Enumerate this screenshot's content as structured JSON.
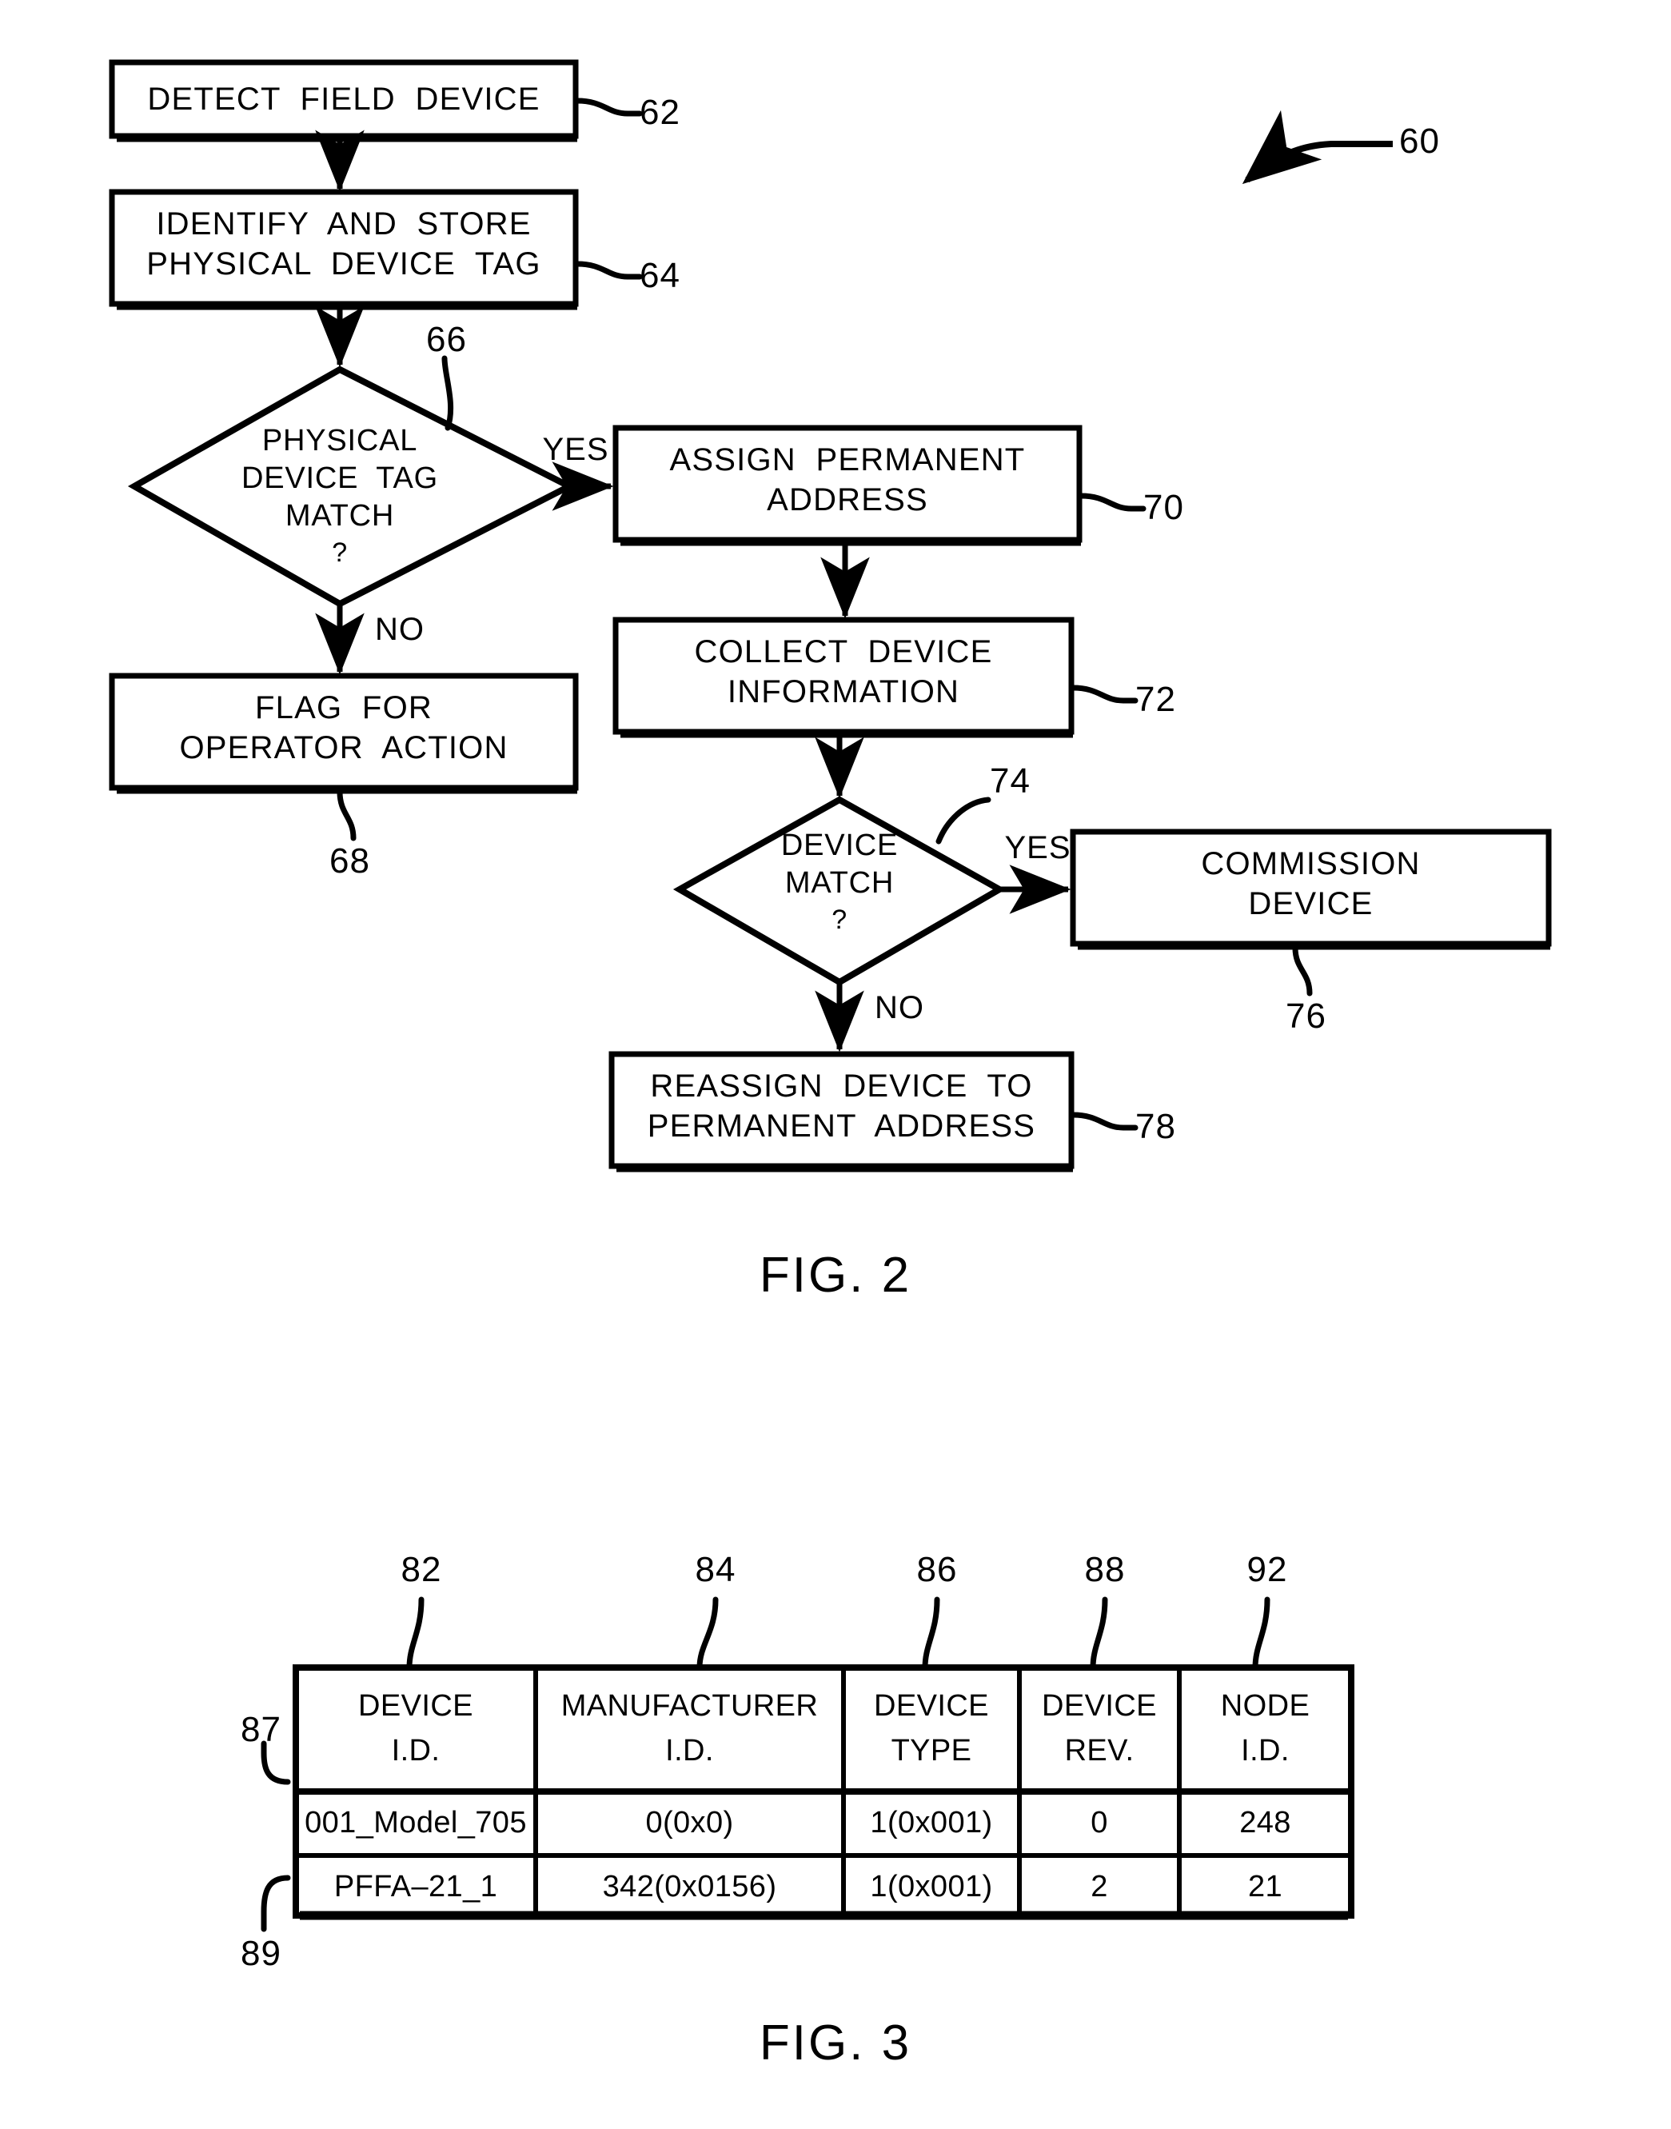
{
  "figure2": {
    "overall_ref": "60",
    "nodes": [
      {
        "id": "n62",
        "ref": "62",
        "type": "process",
        "lines": [
          "DETECT  FIELD  DEVICE"
        ]
      },
      {
        "id": "n64",
        "ref": "64",
        "type": "process",
        "lines": [
          "IDENTIFY  AND  STORE",
          "PHYSICAL  DEVICE  TAG"
        ]
      },
      {
        "id": "n66",
        "ref": "66",
        "type": "decision",
        "lines": [
          "PHYSICAL",
          "DEVICE  TAG",
          "MATCH"
        ],
        "question_mark": "?"
      },
      {
        "id": "n68",
        "ref": "68",
        "type": "process",
        "lines": [
          "FLAG  FOR",
          "OPERATOR  ACTION"
        ]
      },
      {
        "id": "n70",
        "ref": "70",
        "type": "process",
        "lines": [
          "ASSIGN  PERMANENT",
          "ADDRESS"
        ]
      },
      {
        "id": "n72",
        "ref": "72",
        "type": "process",
        "lines": [
          "COLLECT  DEVICE",
          "INFORMATION"
        ]
      },
      {
        "id": "n74",
        "ref": "74",
        "type": "decision",
        "lines": [
          "DEVICE",
          "MATCH"
        ],
        "question_mark": "?"
      },
      {
        "id": "n76",
        "ref": "76",
        "type": "process",
        "lines": [
          "COMMISSION",
          "DEVICE"
        ]
      },
      {
        "id": "n78",
        "ref": "78",
        "type": "process",
        "lines": [
          "REASSIGN  DEVICE  TO",
          "PERMANENT  ADDRESS"
        ]
      }
    ],
    "edge_labels": {
      "tag_match_yes": "YES",
      "tag_match_no": "NO",
      "device_match_yes": "YES",
      "device_match_no": "NO"
    },
    "caption": "FIG. 2"
  },
  "figure3": {
    "caption": "FIG. 3",
    "column_refs": [
      "82",
      "84",
      "86",
      "88",
      "92"
    ],
    "row_refs": [
      "87",
      "89"
    ],
    "headers": [
      [
        "DEVICE",
        "I.D."
      ],
      [
        "MANUFACTURER",
        "I.D."
      ],
      [
        "DEVICE",
        "TYPE"
      ],
      [
        "DEVICE",
        "REV."
      ],
      [
        "NODE",
        "I.D."
      ]
    ],
    "rows": [
      [
        "001_Model_705",
        "0(0x0)",
        "1(0x001)",
        "0",
        "248"
      ],
      [
        "PFFA–21_1",
        "342(0x0156)",
        "1(0x001)",
        "2",
        "21"
      ]
    ]
  },
  "colors": {
    "ink": "#000000",
    "paper": "#ffffff"
  }
}
